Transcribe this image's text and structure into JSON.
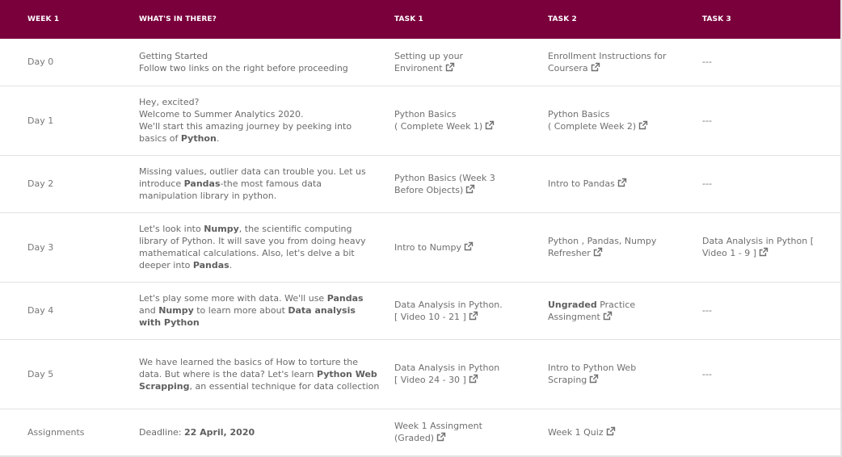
{
  "headers": {
    "week": "WEEK 1",
    "whats": "WHAT'S IN THERE?",
    "task1": "TASK 1",
    "task2": "TASK 2",
    "task3": "TASK 3"
  },
  "icon": "external-link-icon",
  "colors": {
    "header_bg": "#7a003c",
    "header_text": "#ffffff",
    "body_text": "#6f6f6f"
  },
  "rows": [
    {
      "day": "Day 0",
      "desc": {
        "l1": "Getting Started",
        "l2": "Follow two links on the right before proceeding"
      },
      "task1": {
        "a": "Setting up your",
        "b": "Environent"
      },
      "task2": {
        "a": "Enrollment Instructions for",
        "b": "Coursera"
      },
      "task3": "---"
    },
    {
      "day": "Day 1",
      "desc": {
        "l1": "Hey, excited?",
        "l2": "Welcome to Summer Analytics 2020.",
        "l3": "We'll start this amazing journey by peeking into basics of ",
        "b1": "Python",
        "end": "."
      },
      "task1": {
        "a": "Python Basics",
        "b": "( Complete Week 1)"
      },
      "task2": {
        "a": "Python Basics",
        "b": "( Complete Week 2)"
      },
      "task3": "---"
    },
    {
      "day": "Day 2",
      "desc": {
        "t1": "Missing values, outlier data can trouble you. Let us introduce ",
        "b1": "Pandas",
        "t2": "-the most famous data manipulation library in python."
      },
      "task1": {
        "a": "Python Basics (Week 3",
        "b": "Before Objects)"
      },
      "task2": {
        "a": "Intro to Pandas"
      },
      "task3": "---"
    },
    {
      "day": "Day 3",
      "desc": {
        "t1": "Let's look into ",
        "b1": "Numpy",
        "t2": ", the scientific computing library of Python. It will save you from doing heavy mathematical calculations. Also, let's delve a bit deeper into ",
        "b2": "Pandas",
        "t3": "."
      },
      "task1": {
        "a": "Intro to Numpy"
      },
      "task2": {
        "a": "Python , Pandas, Numpy",
        "b": "Refresher"
      },
      "task3": {
        "a": "Data Analysis in Python [",
        "b": "Video 1 - 9 ]"
      }
    },
    {
      "day": "Day 4",
      "desc": {
        "t1": "Let's play some more with data. We'll use ",
        "b1": "Pandas",
        "t2": " and ",
        "b2": "Numpy",
        "t3": " to learn more about ",
        "b3": "Data analysis with Python"
      },
      "task1": {
        "a": "Data Analysis in Python.",
        "b": "[ Video 10 - 21 ]"
      },
      "task2": {
        "bold": "Ungraded",
        "a": " Practice",
        "b": "Assingment"
      },
      "task3": "---"
    },
    {
      "day": "Day 5",
      "desc": {
        "t1": "We have learned the basics of How to torture the data. But where is the data? Let's learn ",
        "b1": "Python Web Scrapping",
        "t2": ", an essential technique for data collection"
      },
      "task1": {
        "a": "Data Analysis in Python",
        "b": "[ Video 24 - 30 ]"
      },
      "task2": {
        "a": "Intro to Python Web",
        "b": "Scraping"
      },
      "task3": "---"
    },
    {
      "day": "Assignments",
      "desc": {
        "t1": "Deadline: ",
        "b1": "22 April, 2020"
      },
      "task1": {
        "a": "Week 1 Assingment",
        "b": "(Graded)"
      },
      "task2": {
        "a": "Week 1 Quiz"
      },
      "task3": ""
    }
  ]
}
